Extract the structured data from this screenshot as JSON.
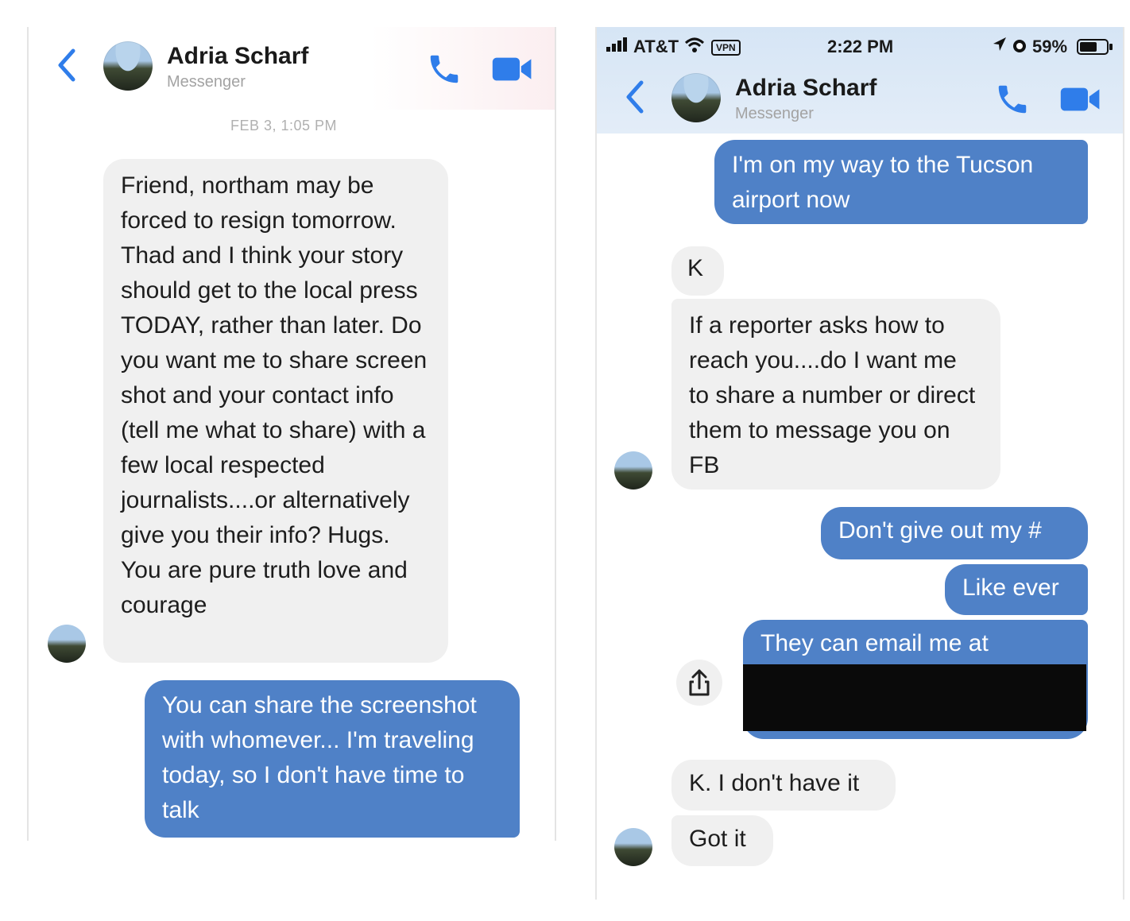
{
  "left": {
    "contact": {
      "name": "Adria Scharf",
      "subtitle": "Messenger"
    },
    "timestamp": "FEB 3, 1:05 PM",
    "messages": [
      {
        "from": "them",
        "text": "Friend, northam may be forced to resign tomorrow. Thad and I think your story should get to the local press TODAY, rather than later. Do you want me to share screen shot and your contact info (tell me what to share) with a few local respected journalists....or alternatively give you their info? Hugs. You are pure truth love and courage"
      },
      {
        "from": "me",
        "text": "You can share the screenshot with whomever... I'm traveling today, so I don't have time to talk"
      }
    ]
  },
  "right": {
    "status_bar": {
      "carrier": "AT&T",
      "vpn": "VPN",
      "time": "2:22 PM",
      "battery": "59%"
    },
    "contact": {
      "name": "Adria Scharf",
      "subtitle": "Messenger"
    },
    "messages": [
      {
        "from": "me",
        "text": "I'm on my way to the Tucson airport now"
      },
      {
        "from": "them",
        "text": "K"
      },
      {
        "from": "them",
        "text": "If a reporter asks how to reach you....do I want me to share a number or direct them to message you on FB"
      },
      {
        "from": "me",
        "text": "Don't give out my #"
      },
      {
        "from": "me",
        "text": "Like ever"
      },
      {
        "from": "me",
        "text": "They can email me at"
      },
      {
        "from": "them",
        "text": "K. I don't have it"
      },
      {
        "from": "them",
        "text": "Got it"
      }
    ]
  },
  "icons": {
    "back": "chevron-left-icon",
    "call": "phone-icon",
    "video": "video-camera-icon",
    "share": "share-icon"
  },
  "colors": {
    "outgoing_bubble": "#4f81c7",
    "incoming_bubble": "#f0f0f0",
    "accent": "#2f7dea",
    "redaction": "#0a0a0a"
  }
}
